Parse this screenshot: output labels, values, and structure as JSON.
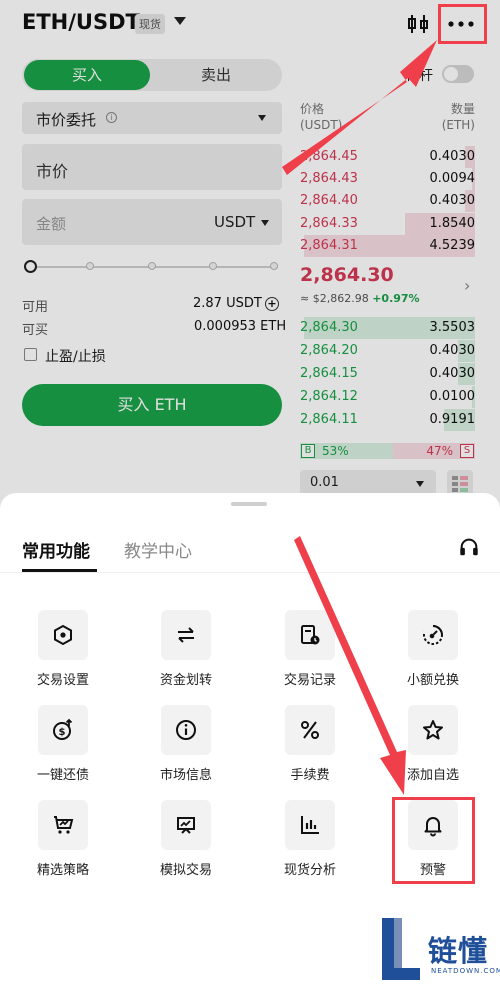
{
  "header": {
    "pair": "ETH/USDT",
    "badge": "现货"
  },
  "trade_tabs": {
    "buy": "买入",
    "sell": "卖出"
  },
  "leverage_label": "杠杆",
  "order_form": {
    "order_type": "市价委托",
    "price_placeholder": "市价",
    "amount_placeholder": "金额",
    "amount_unit": "USDT",
    "available_label": "可用",
    "available_value": "2.87 USDT",
    "buyable_label": "可买",
    "buyable_value": "0.000953 ETH",
    "tp_sl_label": "止盈/止损",
    "submit_label": "买入 ETH",
    "slider_value": 0
  },
  "order_book": {
    "price_header_1": "价格",
    "price_header_2": "(USDT)",
    "qty_header_1": "数量",
    "qty_header_2": "(ETH)",
    "asks": [
      {
        "price": "2,864.45",
        "qty": "0.4030"
      },
      {
        "price": "2,864.43",
        "qty": "0.0094"
      },
      {
        "price": "2,864.40",
        "qty": "0.4030"
      },
      {
        "price": "2,864.33",
        "qty": "1.8540"
      },
      {
        "price": "2,864.31",
        "qty": "4.5239"
      }
    ],
    "last_price": "2,864.30",
    "last_price_fiat": "≈ $2,862.98",
    "change_pct": "+0.97%",
    "bids": [
      {
        "price": "2,864.30",
        "qty": "3.5503"
      },
      {
        "price": "2,864.20",
        "qty": "0.4030"
      },
      {
        "price": "2,864.15",
        "qty": "0.4030"
      },
      {
        "price": "2,864.12",
        "qty": "0.0100"
      },
      {
        "price": "2,864.11",
        "qty": "0.9191"
      }
    ],
    "buy_tag": "B",
    "buy_ratio": "53%",
    "sell_ratio": "47%",
    "sell_tag": "S",
    "depth_step": "0.01"
  },
  "sheet": {
    "tab_active": "常用功能",
    "tab_other": "教学中心",
    "items": [
      {
        "label": "交易设置",
        "icon": "hexagon-settings-icon"
      },
      {
        "label": "资金划转",
        "icon": "transfer-arrows-icon"
      },
      {
        "label": "交易记录",
        "icon": "record-clock-icon"
      },
      {
        "label": "小额兑换",
        "icon": "small-convert-icon"
      },
      {
        "label": "一键还债",
        "icon": "repay-dollar-icon"
      },
      {
        "label": "市场信息",
        "icon": "info-circle-icon"
      },
      {
        "label": "手续费",
        "icon": "percent-icon"
      },
      {
        "label": "添加自选",
        "icon": "star-icon"
      },
      {
        "label": "精选策略",
        "icon": "strategy-chart-icon"
      },
      {
        "label": "模拟交易",
        "icon": "simulated-trade-icon"
      },
      {
        "label": "现货分析",
        "icon": "bar-analysis-icon"
      },
      {
        "label": "预警",
        "icon": "bell-icon"
      }
    ]
  },
  "watermark": {
    "name": "链懂",
    "domain": "NEATDOWN.COM"
  },
  "colors": {
    "buy_green": "#1aa34a",
    "sell_red": "#d63a55",
    "annotation_red": "#ee3f4b"
  }
}
